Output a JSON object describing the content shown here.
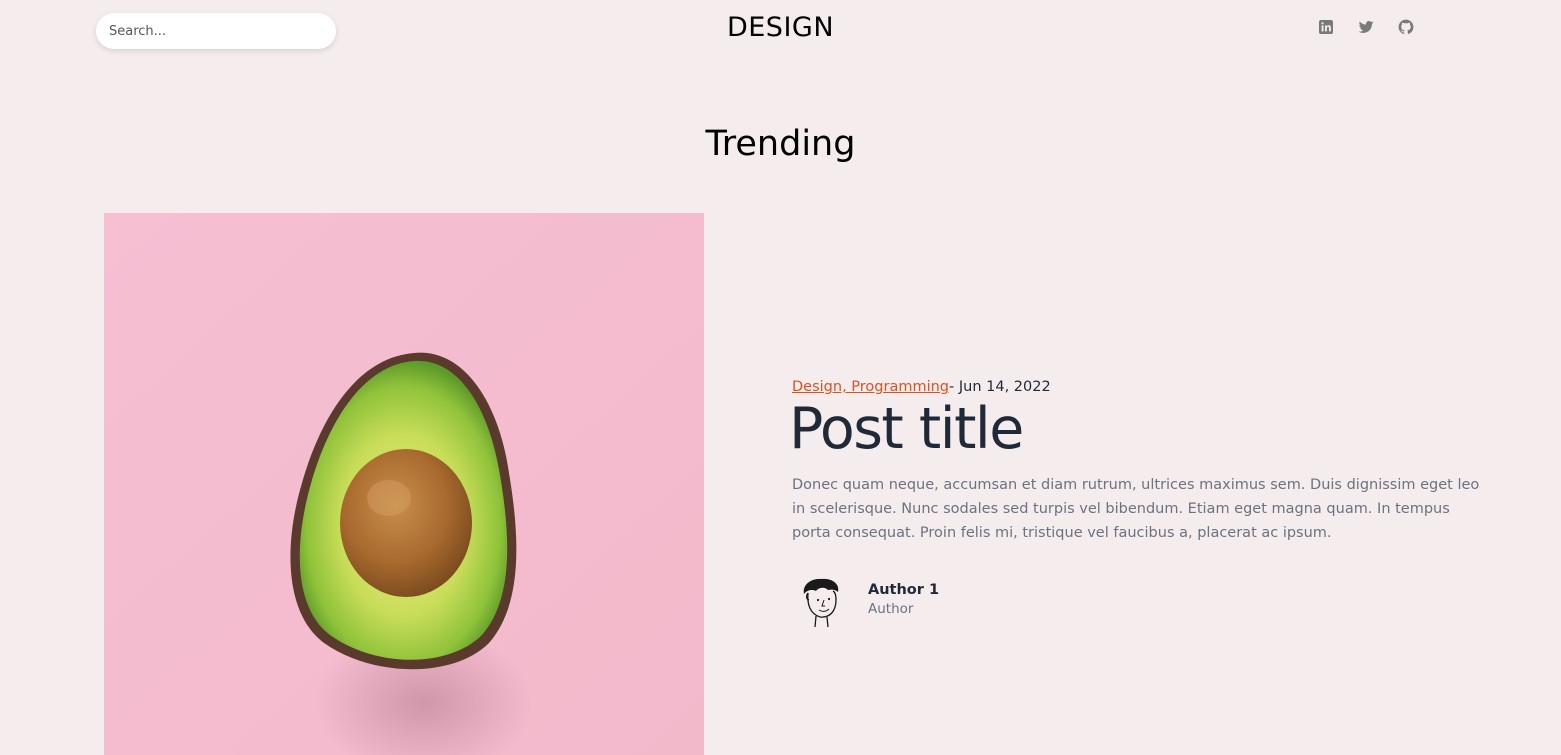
{
  "header": {
    "search_placeholder": "Search...",
    "site_title": "DESIGN",
    "socials": [
      {
        "icon": "linkedin-icon"
      },
      {
        "icon": "twitter-icon"
      },
      {
        "icon": "github-icon"
      }
    ],
    "social_icon_color": "#7a7a7a"
  },
  "section": {
    "heading": "Trending"
  },
  "post": {
    "categories": "Design, Programming",
    "date": "- Jun 14, 2022",
    "title": "Post title",
    "excerpt": "Donec quam neque, accumsan et diam rutrum, ultrices maximus sem. Duis dignissim eget leo in scelerisque. Nunc sodales sed turpis vel bibendum. Etiam eget magna quam. In tempus porta consequat. Proin felis mi, tristique vel faucibus a, placerat ac ipsum.",
    "image": "avocado-image",
    "author": {
      "name": "Author 1",
      "role": "Author",
      "avatar": "author-avatar-illustration"
    }
  },
  "colors": {
    "background": "#f5ecee",
    "accent": "#d9531e",
    "title": "#1f2937",
    "muted": "#6b7280",
    "image_background": "#f4bcd0"
  }
}
